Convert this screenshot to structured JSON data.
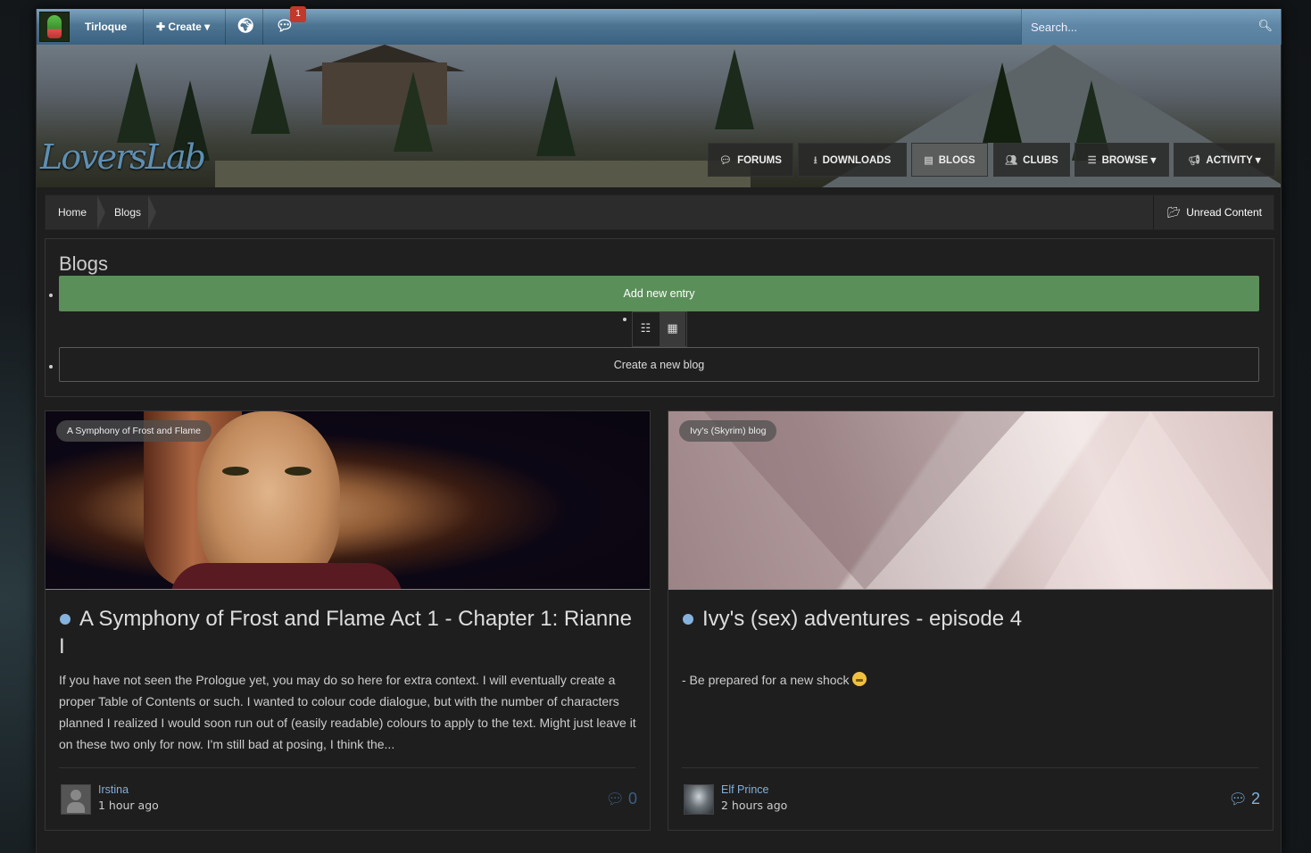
{
  "userbar": {
    "username": "Tirloque",
    "create_label": "Create",
    "notifications_badge": "1",
    "search_placeholder": "Search..."
  },
  "header": {
    "logo_text": "LoversLab",
    "nav": [
      {
        "label": "FORUMS",
        "icon": "comments-icon"
      },
      {
        "label": "DOWNLOADS",
        "icon": "download-icon"
      },
      {
        "label": "BLOGS",
        "icon": "blog-icon",
        "active": true
      },
      {
        "label": "CLUBS",
        "icon": "users-icon"
      },
      {
        "label": "BROWSE",
        "icon": "list-icon"
      },
      {
        "label": "ACTIVITY",
        "icon": "megaphone-icon"
      }
    ]
  },
  "breadcrumb": {
    "items": [
      "Home",
      "Blogs"
    ],
    "unread_label": "Unread Content"
  },
  "blogs": {
    "title": "Blogs",
    "add_entry_label": "Add new entry",
    "create_blog_label": "Create a new blog",
    "view_modes": [
      "list-view-icon",
      "grid-view-icon"
    ],
    "active_view": "grid-view-icon"
  },
  "entries": [
    {
      "blog_name": "A Symphony of Frost and Flame",
      "title": "A Symphony of Frost and Flame Act 1 - Chapter 1: Rianne I",
      "excerpt": "If you have not seen the Prologue yet, you may do so here for extra context. I will eventually create a proper Table of Contents or such.   I wanted to colour code dialogue, but with the number of characters planned I realized I would soon run out of (easily readable) colours to apply to the text. Might just leave it on these two only for now.   I'm still bad at posing, I think the...",
      "author": "Irstina",
      "time": "1 hour ago",
      "comments": "0",
      "comment_color": "#3c5f82"
    },
    {
      "blog_name": "Ivy's (Skyrim) blog",
      "title": "Ivy's (sex) adventures - episode 4",
      "excerpt": "- Be prepared for a new shock",
      "author": "Elf Prince",
      "time": "2 hours ago",
      "comments": "2",
      "comment_color": "#7fb0dc"
    }
  ]
}
